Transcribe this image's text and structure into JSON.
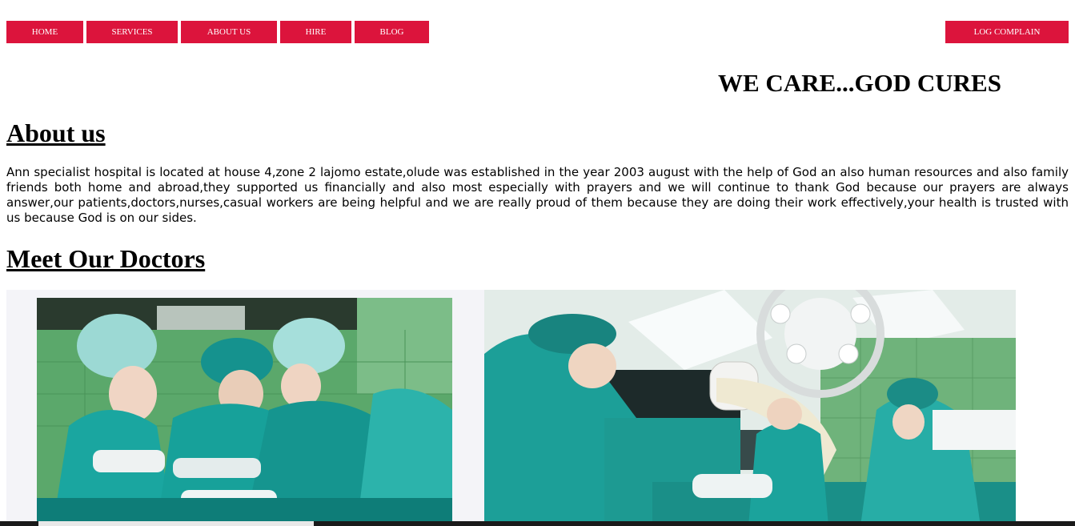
{
  "nav": {
    "home": "HOME",
    "services": "SERVICES",
    "about": "ABOUT US",
    "hire": "HIRE",
    "blog": "BLOG",
    "log_complain": "LOG COMPLAIN"
  },
  "tagline": "WE CARE...GOD CURES",
  "about": {
    "heading": "About us",
    "text": "Ann specialist hospital is located at house 4,zone 2 lajomo estate,olude was established in the year 2003 august with the help of God an also human resources and also family friends both home and abroad,they supported us financially and also most especially with prayers and we will continue to thank God because our prayers are always answer,our patients,doctors,nurses,casual workers are being helpful and we are really proud of them because they are doing their work effectively,your health is trusted with us because God is on our sides."
  },
  "doctors": {
    "heading": "Meet Our Doctors"
  },
  "colors": {
    "nav_bg": "#dc143c",
    "nav_text": "#ffffff"
  }
}
